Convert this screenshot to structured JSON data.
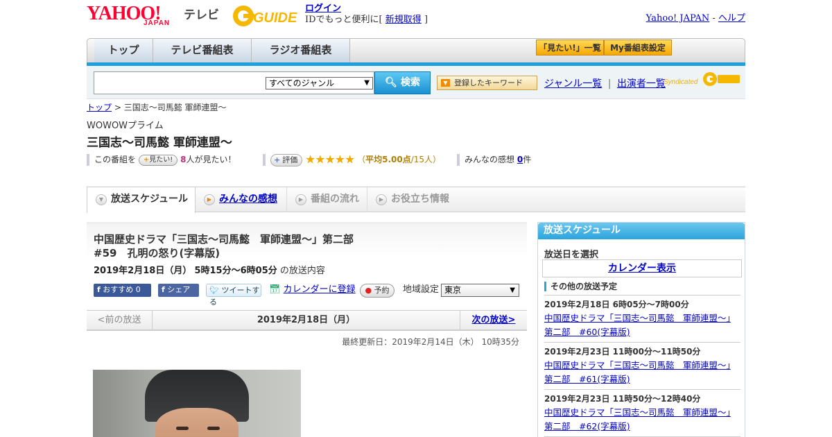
{
  "header": {
    "logo_yahoo": "YAHOO!",
    "logo_japan": "JAPAN",
    "logo_tv": "テレビ",
    "logo_guide": "GUIDE",
    "login": "ログイン",
    "login_note_prefix": "IDでもっと便利に[",
    "signup": "新規取得",
    "login_note_suffix": "]",
    "yahoo_japan_link": "Yahoo! JAPAN",
    "separator": "-",
    "help_link": "ヘルプ"
  },
  "nav": {
    "tabs": [
      "トップ",
      "テレビ番組表",
      "ラジオ番組表"
    ],
    "mitai_list": "「見たい!」一覧",
    "my_schedule": "My番組表設定"
  },
  "search": {
    "genre_selected": "すべてのジャンル",
    "search_button": "検索",
    "keyword_button": "登録したキーワード",
    "genre_list_link": "ジャンル一覧",
    "divider": "|",
    "performer_list_link": "出演者一覧",
    "syndicated": "Syndicated"
  },
  "breadcrumb": {
    "top": "トップ",
    "sep": ">",
    "current": "三国志～司馬懿 軍師連盟～"
  },
  "program": {
    "channel": "WOWOWプライム",
    "title": "三国志～司馬懿 軍師連盟～",
    "watch_prefix": "この番組を",
    "mitai_button": "見たい!",
    "watch_count": "8",
    "watch_suffix": "人が見たい！",
    "rate_button": "評価",
    "stars": "★★★★★",
    "rating_prefix": "（",
    "rating_label": "平均5.00点",
    "rating_suffix": "/15人）",
    "reviews_prefix": "みんなの感想",
    "reviews_count": "0",
    "reviews_suffix": "件"
  },
  "tabs": {
    "schedule": "放送スケジュール",
    "reviews": "みんなの感想",
    "flow": "番組の流れ",
    "info": "お役立ち情報"
  },
  "episode": {
    "title_line1": "中国歴史ドラマ「三国志～司馬懿　軍師連盟～」第二部",
    "title_line2": "#59　孔明の怒り(字幕版)",
    "date": "2019年2月18日（月）",
    "time": "5時15分～6時05分",
    "date_suffix": "の放送内容",
    "fb_recommend": "おすすめ 0",
    "fb_share": "シェア",
    "tweet": "ツイートする",
    "calendar_link": "カレンダーに登録",
    "reserve": "予約",
    "region_label": "地域設定",
    "region_value": "東京"
  },
  "pager": {
    "prev": "<前の放送",
    "current": "2019年2月18日（月）",
    "next": "次の放送>"
  },
  "updated": "最終更新日：2019年2月14日（木） 10時35分",
  "sidebar": {
    "heading": "放送スケジュール",
    "choose_date": "放送日を選択",
    "calendar": "カレンダー表示",
    "other_heading": "その他の放送予定",
    "items": [
      {
        "when": "2019年2月18日 6時05分～7時00分",
        "title": "中国歴史ドラマ「三国志～司馬懿　軍師連盟～」第二部　#60(字幕版)"
      },
      {
        "when": "2019年2月23日 11時00分～11時50分",
        "title": "中国歴史ドラマ「三国志～司馬懿　軍師連盟～」第二部　#61(字幕版)"
      },
      {
        "when": "2019年2月23日 11時50分～12時40分",
        "title": "中国歴史ドラマ「三国志～司馬懿　軍師連盟～」第二部　#62(字幕版)"
      }
    ]
  },
  "colors": {
    "yahoo_red": "#ff0033",
    "accent_blue": "#1fa0de",
    "guide_yellow": "#f5b700",
    "link": "#0000cc",
    "star": "#f2a900"
  }
}
